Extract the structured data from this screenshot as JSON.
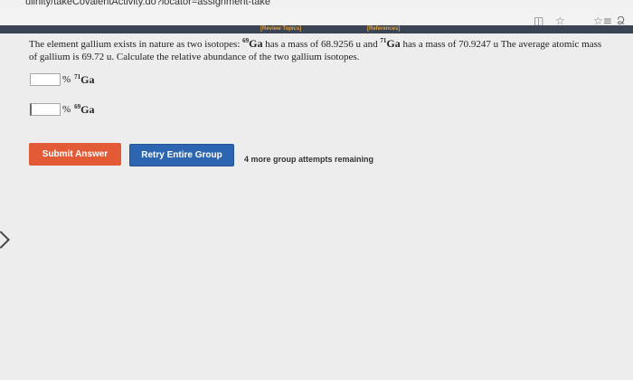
{
  "browser": {
    "url": "ulinity/takeCovalentActivity.do?locator=assignment-take"
  },
  "toolbar": {
    "icons": [
      "reader-view-icon",
      "bookmark-star-icon",
      "favorites-icon",
      "profile-icon"
    ],
    "reader_glyph": "◫",
    "star_glyph": "☆",
    "fav_glyph": "☆≡",
    "profile_glyph": "Ձ"
  },
  "links": {
    "review_topics": "[Review Topics]",
    "references": "[References]"
  },
  "question": {
    "part1": "The element gallium exists in nature as two isotopes: ",
    "iso69_mass": "69",
    "iso69_symbol": "Ga",
    "part2": " has a mass of 68.9256 u and ",
    "iso71_mass": "71",
    "iso71_symbol": "Ga",
    "part3": " has a mass of 70.9247 u The average atomic mass of gallium is 69.72 u. Calculate the relative abundance of the two gallium isotopes."
  },
  "answers": [
    {
      "value": "",
      "unit": "%",
      "mass": "71",
      "symbol": "Ga"
    },
    {
      "value": "",
      "unit": "%",
      "mass": "69",
      "symbol": "Ga"
    }
  ],
  "buttons": {
    "submit": "Submit Answer",
    "retry": "Retry Entire Group"
  },
  "status": {
    "attempts": "4 more group attempts remaining"
  },
  "colors": {
    "submit_bg": "#e25a36",
    "retry_bg": "#2d66b0",
    "header_bar": "#3a4454",
    "link": "#e8a640"
  }
}
